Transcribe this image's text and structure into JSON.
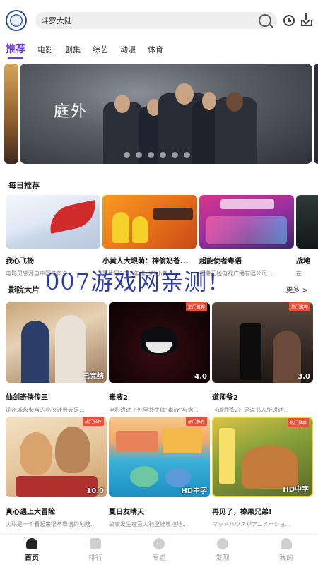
{
  "search": {
    "value": "斗罗大陆"
  },
  "tabs": [
    "推荐",
    "电影",
    "剧集",
    "综艺",
    "动漫",
    "体育"
  ],
  "banner": {
    "title": "庭外"
  },
  "sections": {
    "daily": {
      "title": "每日推荐"
    },
    "movies": {
      "title": "影院大片",
      "more": "更多 >"
    }
  },
  "daily": [
    {
      "name": "我心飞扬",
      "desc": "电影灵感源自中国冬奥会..."
    },
    {
      "name": "小黄人大眼萌：神偷奶爸...",
      "desc": "影片是2015年推出的小黄..."
    },
    {
      "name": "超能使者粤语",
      "desc": "香港无线电视广播有限公司..."
    },
    {
      "name": "战地",
      "desc": "在"
    }
  ],
  "movies": [
    {
      "name": "仙剑奇侠传三",
      "desc": "渝州城永安当的小伙计景天是...",
      "badge": "",
      "score": "已完结"
    },
    {
      "name": "毒液2",
      "desc": "电影讲述了外星共生体\"毒液\"与宿...",
      "badge": "热门推荐",
      "score": "4.0"
    },
    {
      "name": "道师爷2",
      "desc": "《道师爷2》是说书人所讲述...",
      "badge": "热门推荐",
      "score": "3.0"
    },
    {
      "name": "真心遇上大冒险",
      "desc": "大聪是一个看起来很不靠谱的地陪...",
      "badge": "热门推荐",
      "score": "10.0"
    },
    {
      "name": "夏日友晴天",
      "desc": "故事发生在意大利里维埃拉地...",
      "badge": "热门推荐",
      "score": "HD中字"
    },
    {
      "name": "再见了，橡果兄弟!",
      "desc": "マッドハウスがアニメーショ...",
      "badge": "热门推荐",
      "score": "HD中字"
    }
  ],
  "watermark": "007游戏网亲测！",
  "bottom_nav": [
    {
      "label": "首页",
      "icon": "home-icon"
    },
    {
      "label": "排行",
      "icon": "grid-icon"
    },
    {
      "label": "专题",
      "icon": "topic-icon"
    },
    {
      "label": "发现",
      "icon": "play-icon"
    },
    {
      "label": "我的",
      "icon": "user-icon"
    }
  ],
  "colors": {
    "accent": "#6a3fd0",
    "badge": "#e9503a",
    "watermark": "#2b3aa8"
  }
}
